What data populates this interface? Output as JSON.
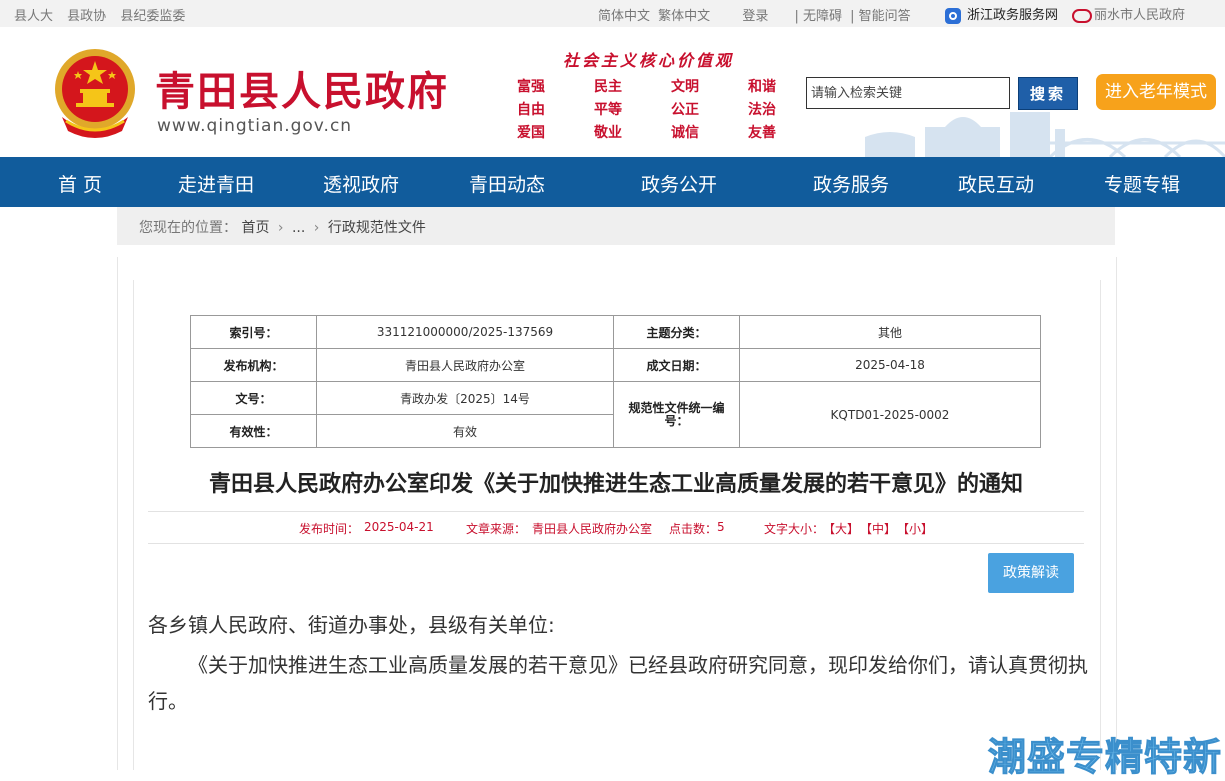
{
  "topbar": {
    "left_links": [
      "县人大",
      "县政协",
      "县纪委监委"
    ],
    "simplified": "简体中文",
    "traditional": "繁体中文",
    "login": "登录",
    "accessible": "| 无障碍",
    "smart_qa": "| 智能问答",
    "zj_portal": "浙江政务服务网",
    "lishui": "丽水市人民政府"
  },
  "header": {
    "site_title": "青田县人民政府",
    "site_url": "www.qingtian.gov.cn",
    "values_title": "社会主义核心价值观",
    "values": [
      "富强",
      "民主",
      "文明",
      "和谐",
      "自由",
      "平等",
      "公正",
      "法治",
      "爱国",
      "敬业",
      "诚信",
      "友善"
    ],
    "search_placeholder": "请输入检索关键",
    "search_button": "搜索",
    "elder_mode": "进入老年模式"
  },
  "nav": {
    "items": [
      "首 页",
      "走进青田",
      "透视政府",
      "青田动态",
      "政务公开",
      "政务服务",
      "政民互动",
      "专题专辑"
    ]
  },
  "breadcrumb": {
    "prefix": "您现在的位置：",
    "home": "首页",
    "ellipsis": "...",
    "current": "行政规范性文件"
  },
  "meta": {
    "index_label": "索引号：",
    "index_value": "331121000000/2025-137569",
    "topic_label": "主题分类：",
    "topic_value": "其他",
    "publisher_label": "发布机构：",
    "publisher_value": "青田县人民政府办公室",
    "date_label": "成文日期：",
    "date_value": "2025-04-18",
    "docno_label": "文号：",
    "docno_value": "青政办发〔2025〕14号",
    "code_label": "规范性文件统一编号：",
    "code_value": "KQTD01-2025-0002",
    "validity_label": "有效性：",
    "validity_value": "有效"
  },
  "article": {
    "title": "青田县人民政府办公室印发《关于加快推进生态工业高质量发展的若干意见》的通知",
    "publish_label": "发布时间：",
    "publish_date": "2025-04-21",
    "source_label": "文章来源：",
    "source_value": "青田县人民政府办公室",
    "clicks_label": "点击数：",
    "clicks_value": "5",
    "font_label": "文字大小：",
    "font_large": "【大】",
    "font_medium": "【中】",
    "font_small": "【小】",
    "interpret_button": "政策解读",
    "salutation": "各乡镇人民政府、街道办事处，县级有关单位:",
    "body": "《关于加快推进生态工业高质量发展的若干意见》已经县政府研究同意，现印发给你们，请认真贯彻执行。"
  },
  "watermark": "潮盛专精特新",
  "colors": {
    "brand_red": "#c8102e",
    "nav_blue": "#115c9c",
    "elder_orange": "#f7a21b",
    "button_blue": "#4aa2e0"
  },
  "icons": {
    "emblem": "national-emblem-icon",
    "zj": "zhejiang-portal-icon",
    "lishui": "lishui-logo-icon"
  }
}
